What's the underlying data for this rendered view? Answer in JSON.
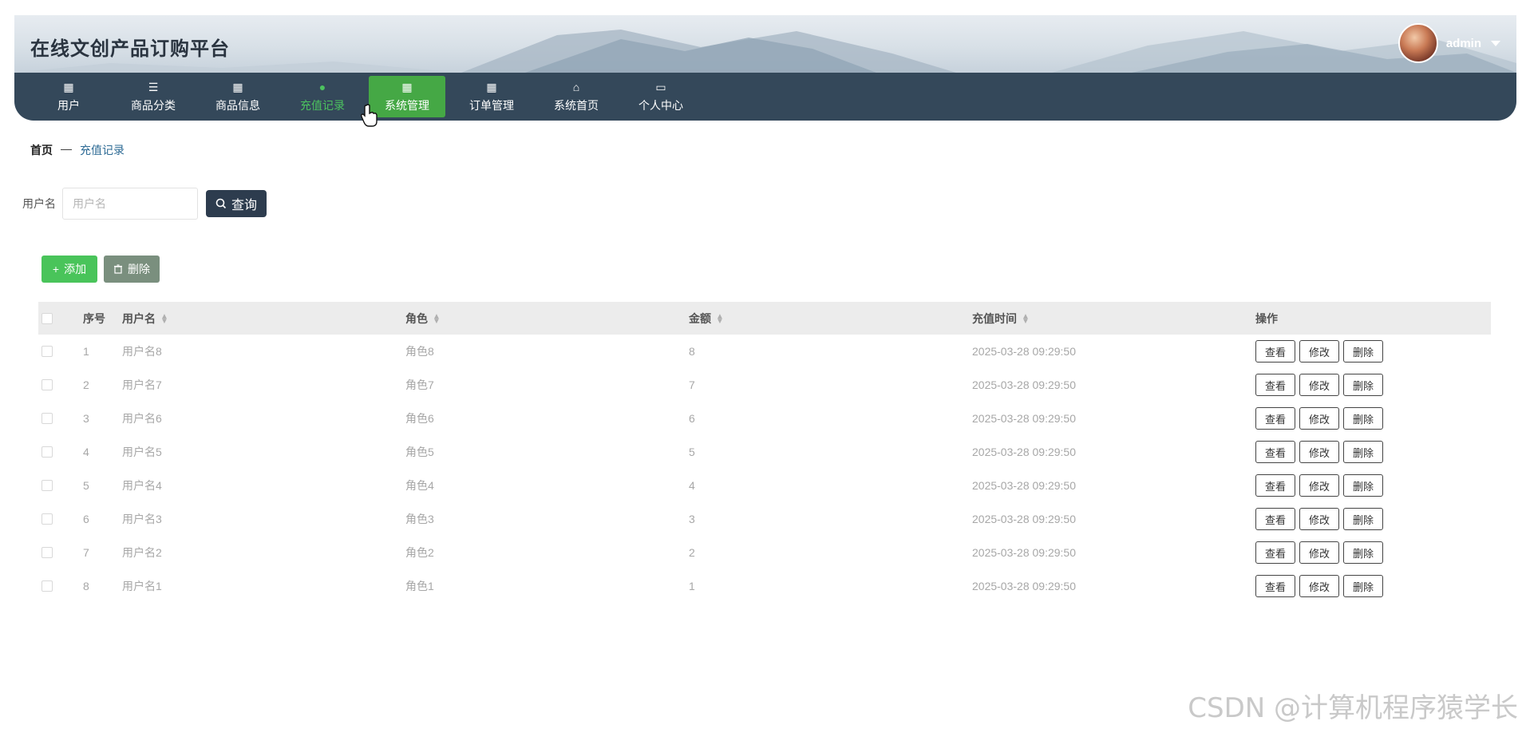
{
  "header": {
    "title": "在线文创产品订购平台",
    "username": "admin"
  },
  "nav": {
    "items": [
      {
        "label": "用户",
        "icon": "grid-icon"
      },
      {
        "label": "商品分类",
        "icon": "sliders-icon"
      },
      {
        "label": "商品信息",
        "icon": "grid-icon"
      },
      {
        "label": "充值记录",
        "icon": "location-icon"
      },
      {
        "label": "系统管理",
        "icon": "grid-icon"
      },
      {
        "label": "订单管理",
        "icon": "grid-icon"
      },
      {
        "label": "系统首页",
        "icon": "home-icon"
      },
      {
        "label": "个人中心",
        "icon": "wallet-icon"
      }
    ],
    "current_index": 3,
    "hover_index": 4
  },
  "breadcrumb": {
    "home": "首页",
    "sep": "—",
    "current": "充值记录"
  },
  "search": {
    "label": "用户名",
    "placeholder": "用户名",
    "button": "查询"
  },
  "actions": {
    "add": "添加",
    "delete": "删除"
  },
  "table": {
    "headers": {
      "index": "序号",
      "username": "用户名",
      "role": "角色",
      "amount": "金额",
      "time": "充值时间",
      "ops": "操作"
    },
    "rows": [
      {
        "index": "1",
        "username": "用户名8",
        "role": "角色8",
        "amount": "8",
        "time": "2025-03-28 09:29:50"
      },
      {
        "index": "2",
        "username": "用户名7",
        "role": "角色7",
        "amount": "7",
        "time": "2025-03-28 09:29:50"
      },
      {
        "index": "3",
        "username": "用户名6",
        "role": "角色6",
        "amount": "6",
        "time": "2025-03-28 09:29:50"
      },
      {
        "index": "4",
        "username": "用户名5",
        "role": "角色5",
        "amount": "5",
        "time": "2025-03-28 09:29:50"
      },
      {
        "index": "5",
        "username": "用户名4",
        "role": "角色4",
        "amount": "4",
        "time": "2025-03-28 09:29:50"
      },
      {
        "index": "6",
        "username": "用户名3",
        "role": "角色3",
        "amount": "3",
        "time": "2025-03-28 09:29:50"
      },
      {
        "index": "7",
        "username": "用户名2",
        "role": "角色2",
        "amount": "2",
        "time": "2025-03-28 09:29:50"
      },
      {
        "index": "8",
        "username": "用户名1",
        "role": "角色1",
        "amount": "1",
        "time": "2025-03-28 09:29:50"
      }
    ],
    "op_labels": {
      "view": "查看",
      "edit": "修改",
      "delete": "删除"
    }
  },
  "watermark": "CSDN @计算机程序猿学长",
  "colors": {
    "nav_bg": "#34485a",
    "nav_current": "#4cc25f",
    "nav_hover_bg": "#45a845",
    "search_btn": "#2d3c4e",
    "add_btn": "#49c45a",
    "del_btn": "#7a8f7e"
  }
}
